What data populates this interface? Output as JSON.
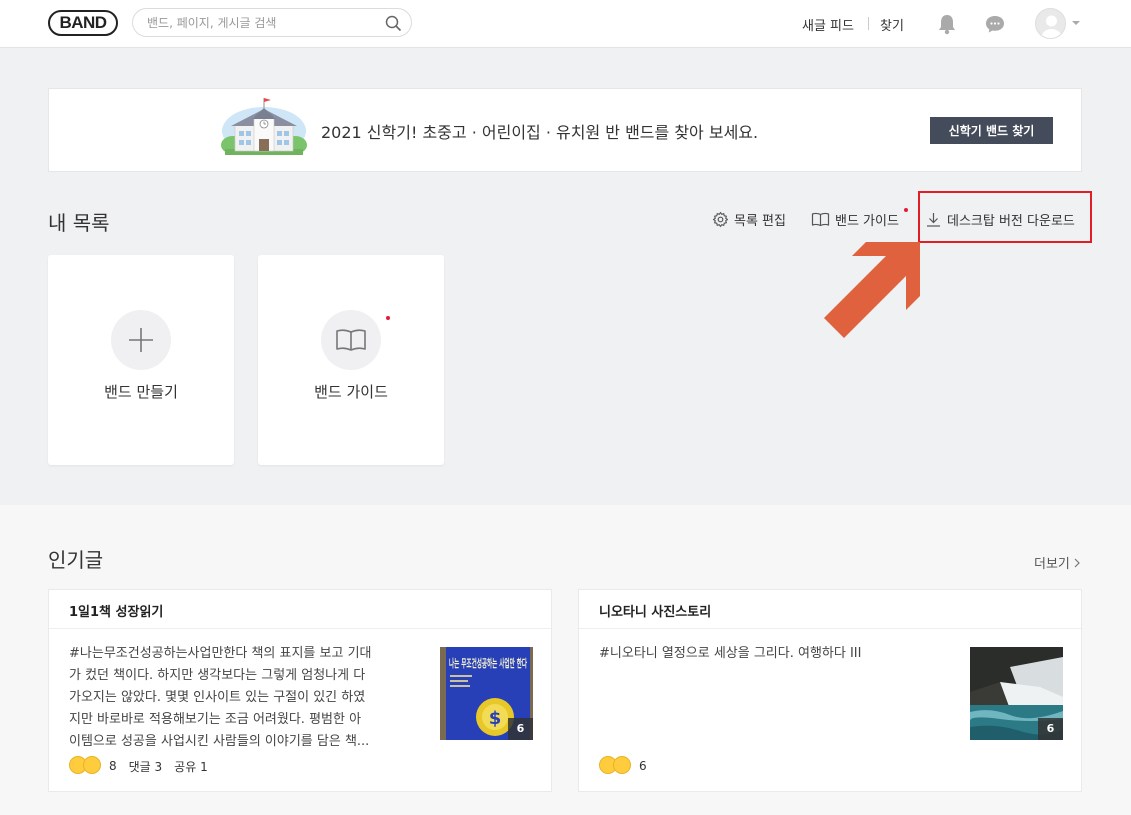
{
  "header": {
    "logo": "BAND",
    "search_placeholder": "밴드, 페이지, 게시글 검색",
    "nav_feed": "새글 피드",
    "nav_find": "찾기"
  },
  "banner": {
    "text": "2021 신학기! 초중고 · 어린이집 · 유치원 반 밴드를 찾아 보세요.",
    "button": "신학기 밴드 찾기"
  },
  "my_list": {
    "title": "내 목록",
    "toolbar": {
      "edit": "목록 편집",
      "guide": "밴드 가이드",
      "download": "데스크탑 버전 다운로드"
    },
    "cards": [
      {
        "label": "밴드 만들기",
        "icon": "plus-icon"
      },
      {
        "label": "밴드 가이드",
        "icon": "book-icon"
      }
    ]
  },
  "popular": {
    "title": "인기글",
    "more": "더보기",
    "posts": [
      {
        "band": "1일1책 성장읽기",
        "lines": [
          "#나는무조건성공하는사업만한다 책의 표지를 보고 기대",
          "가 컸던 책이다. 하지만 생각보다는 그렇게 엄청나게 다",
          "가오지는 않았다. 몇몇 인사이트 있는 구절이 있긴 하였",
          "지만 바로바로 적용해보기는 조금 어려웠다. 평범한 아",
          "이템으로 성공을 사업시킨 사람들의 이야기를 담은 책..."
        ],
        "thumb_count": "6",
        "thumb_title": "나는 무조건성공하는 사업만 한다",
        "reactions": "8",
        "comments": "댓글 3",
        "shares": "공유 1"
      },
      {
        "band": "니오타니 사진스토리",
        "lines": [
          "#니오타니 열정으로 세상을 그리다. 여행하다 III"
        ],
        "thumb_count": "6",
        "reactions": "6"
      }
    ]
  },
  "colors": {
    "accent_red": "#e21d26",
    "arrow": "#e0613d",
    "banner_button": "#444b5a"
  }
}
